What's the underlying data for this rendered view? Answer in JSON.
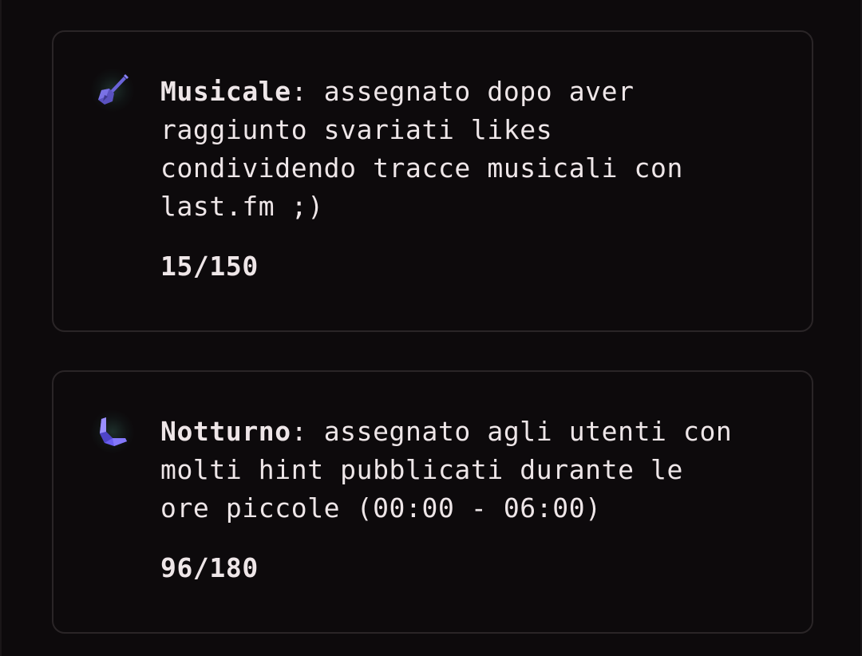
{
  "badges": [
    {
      "icon": "guitar-icon",
      "icon_color": "#6a63d8",
      "name": "Musicale",
      "separator": ": ",
      "description": "assegnato dopo aver\nraggiunto svariati likes\ncondividendo tracce musicali con\nlast.fm ;)",
      "progress_text": "15/150",
      "progress": {
        "current": 15,
        "total": 150
      }
    },
    {
      "icon": "moon-icon",
      "icon_color": "#7a6ef0",
      "name": "Notturno",
      "separator": ": ",
      "description": "assegnato agli utenti con\nmolti hint pubblicati durante le\nore piccole (00:00 - 06:00)",
      "progress_text": "96/180",
      "progress": {
        "current": 96,
        "total": 180
      }
    }
  ]
}
